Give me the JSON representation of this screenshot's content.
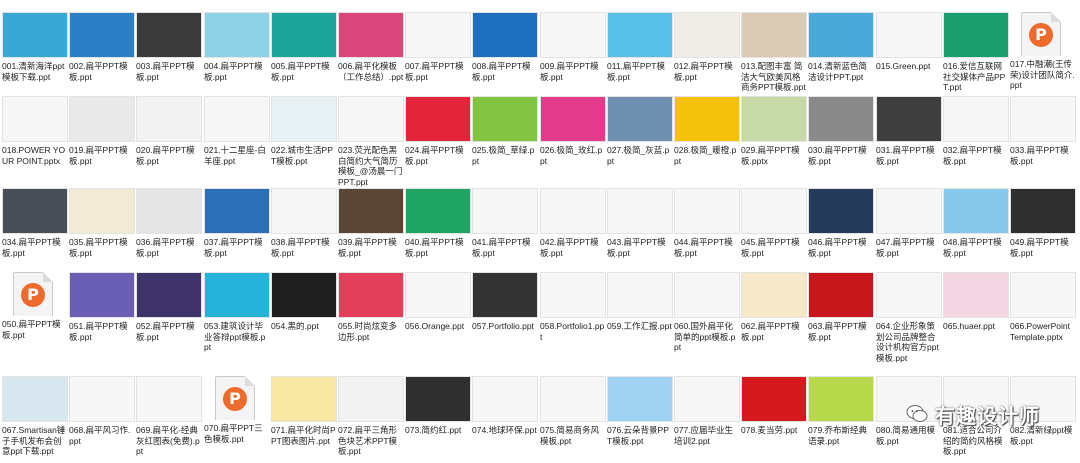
{
  "files": [
    {
      "name": "001.清新海洋ppt模板下载.ppt",
      "t": "sea"
    },
    {
      "name": "002.扁平PPT模板.ppt",
      "t": "blue"
    },
    {
      "name": "003.扁平PPT模板.ppt",
      "t": "dark"
    },
    {
      "name": "004.扁平PPT模板.ppt",
      "t": "lightblue"
    },
    {
      "name": "005.扁平PPT模板.ppt",
      "t": "teal"
    },
    {
      "name": "006.扁平化模板（工作总结）.ppt",
      "t": "pink"
    },
    {
      "name": "007.扁平PPT模板.ppt",
      "t": "white"
    },
    {
      "name": "008.扁平PPT模板.ppt",
      "t": "blue2"
    },
    {
      "name": "009.扁平PPT模板.ppt",
      "t": "white"
    },
    {
      "name": "011.扁平PPT模板.ppt",
      "t": "sky"
    },
    {
      "name": "012.扁平PPT模板.ppt",
      "t": "paper"
    },
    {
      "name": "013.配图丰富 简洁大气欧美风格商务PPT模板.ppt",
      "t": "beige"
    },
    {
      "name": "014.清新蓝色简洁设计PPT.ppt",
      "t": "social"
    },
    {
      "name": "015.Green.ppt",
      "t": "white"
    },
    {
      "name": "016.爱信互联网社交媒体产品PPT.ppt",
      "t": "green"
    },
    {
      "name": "017.中融潮(王传荣)设计团队简介.ppt",
      "t": "file"
    },
    {
      "name": "018.POWER YOUR POINT.pptx",
      "t": "white"
    },
    {
      "name": "019.扁平PPT模板.ppt",
      "t": "people"
    },
    {
      "name": "020.扁平PPT模板.ppt",
      "t": "leaves"
    },
    {
      "name": "021.十二星座-白羊座.ppt",
      "t": "white"
    },
    {
      "name": "022.城市生活PPT模板.ppt",
      "t": "city"
    },
    {
      "name": "023.荧光配色黑白简约大气简历模板_@汤晨一门PPT.ppt",
      "t": "white"
    },
    {
      "name": "024.扁平PPT模板.ppt",
      "t": "red"
    },
    {
      "name": "025.极简_草绿.ppt",
      "t": "lime"
    },
    {
      "name": "026.极简_玫红.ppt",
      "t": "magenta"
    },
    {
      "name": "027.极简_灰蓝.ppt",
      "t": "greyblue"
    },
    {
      "name": "028.极简_暖橙.ppt",
      "t": "yellow"
    },
    {
      "name": "029.扁平PPT模板.pptx",
      "t": "greenL"
    },
    {
      "name": "030.扁平PPT模板.ppt",
      "t": "grey"
    },
    {
      "name": "031.扁平PPT模板.ppt",
      "t": "orangeD"
    },
    {
      "name": "032.扁平PPT模板.ppt",
      "t": "white"
    },
    {
      "name": "033.扁平PPT模板.ppt",
      "t": "white"
    },
    {
      "name": "034.扁平PPT模板.ppt",
      "t": "darkslate"
    },
    {
      "name": "035.扁平PPT模板.ppt",
      "t": "cream"
    },
    {
      "name": "036.扁平PPT模板.ppt",
      "t": "stripes"
    },
    {
      "name": "037.扁平PPT模板.ppt",
      "t": "techful"
    },
    {
      "name": "038.扁平PPT模板.ppt",
      "t": "white"
    },
    {
      "name": "039.扁平PPT模板.ppt",
      "t": "brown"
    },
    {
      "name": "040.扁平PPT模板.ppt",
      "t": "green2"
    },
    {
      "name": "041.扁平PPT模板.ppt",
      "t": "white"
    },
    {
      "name": "042.扁平PPT模板.ppt",
      "t": "white"
    },
    {
      "name": "043.扁平PPT模板.ppt",
      "t": "white"
    },
    {
      "name": "044.扁平PPT模板.ppt",
      "t": "white"
    },
    {
      "name": "045.扁平PPT模板.ppt",
      "t": "white"
    },
    {
      "name": "046.扁平PPT模板.ppt",
      "t": "navy"
    },
    {
      "name": "047.扁平PPT模板.ppt",
      "t": "white"
    },
    {
      "name": "048.扁平PPT模板.ppt",
      "t": "skyline"
    },
    {
      "name": "049.扁平PPT模板.ppt",
      "t": "charcoal"
    },
    {
      "name": "050.扁平PPT模板.ppt",
      "t": "file"
    },
    {
      "name": "051.扁平PPT模板.ppt",
      "t": "violet"
    },
    {
      "name": "052.扁平PPT模板.ppt",
      "t": "purpleD"
    },
    {
      "name": "053.建筑设计毕业答辩ppt模板.ppt",
      "t": "cyan"
    },
    {
      "name": "054.黑的.ppt",
      "t": "black"
    },
    {
      "name": "055.时尚炫变多边形.ppt",
      "t": "poly"
    },
    {
      "name": "056.Orange.ppt",
      "t": "white"
    },
    {
      "name": "057.Portfolio.ppt",
      "t": "portfolio"
    },
    {
      "name": "058.Portfolio1.ppt",
      "t": "white"
    },
    {
      "name": "059.工作汇报.ppt",
      "t": "white"
    },
    {
      "name": "060.国外扁平化简单的ppt模板.ppt",
      "t": "white"
    },
    {
      "name": "062.扁平PPT模板.ppt",
      "t": "bunting"
    },
    {
      "name": "063.扁平PPT模板.ppt",
      "t": "redfest"
    },
    {
      "name": "064.企业形象策划公司品牌整合设计机构官方ppt模板.ppt",
      "t": "white"
    },
    {
      "name": "065.huaer.ppt",
      "t": "pinkL"
    },
    {
      "name": "066.PowerPoint Template.pptx",
      "t": "white"
    },
    {
      "name": "067.Smartisan锤子手机发布会创意ppt下载.ppt",
      "t": "cartoon"
    },
    {
      "name": "068.扁平风习作.ppt",
      "t": "white"
    },
    {
      "name": "069.扁平化-经典灰红图表(免费).ppt",
      "t": "white"
    },
    {
      "name": "070.扁平PPT三色模板.ppt",
      "t": "file"
    },
    {
      "name": "071.扁平化时尚PPT图表图片.ppt",
      "t": "yellowL"
    },
    {
      "name": "072.扁平三角形色块艺术PPT模板.ppt",
      "t": "triangle"
    },
    {
      "name": "073.简约红.ppt",
      "t": "charcoal"
    },
    {
      "name": "074.地球环保.ppt",
      "t": "white"
    },
    {
      "name": "075.简易商务风模板.ppt",
      "t": "white"
    },
    {
      "name": "076.云朵背景PPT模板.ppt",
      "t": "clouds"
    },
    {
      "name": "077.应届毕业生培训2.ppt",
      "t": "white"
    },
    {
      "name": "078.麦当劳.ppt",
      "t": "mcd"
    },
    {
      "name": "079.乔布斯经典语录.ppt",
      "t": "colorful"
    },
    {
      "name": "080.简易通用模板.ppt",
      "t": "white"
    },
    {
      "name": "081.适合公司介绍的简约风格模板.ppt",
      "t": "white"
    },
    {
      "name": "082.清新绿ppt模板.ppt",
      "t": "white"
    }
  ],
  "watermark": {
    "text": "有趣设计师"
  },
  "colors": {
    "sea": "#38a9d6",
    "blue": "#2b7fc4",
    "dark": "#3a3a3a",
    "lightblue": "#8fd2e6",
    "teal": "#1ba59b",
    "pink": "#d9477a",
    "white": "#f7f7f7",
    "blue2": "#1f6fbf",
    "sky": "#58c0e8",
    "paper": "#f0ece6",
    "beige": "#d9cbb6",
    "social": "#4aa8d8",
    "green": "#1a9e6e",
    "people": "#e9e9e9",
    "leaves": "#f3f3f3",
    "city": "#e8f1f4",
    "red": "#e4243b",
    "lime": "#82c341",
    "magenta": "#e23b8c",
    "greyblue": "#6e8fb0",
    "yellow": "#f4c20d",
    "greenL": "#c6d9a6",
    "grey": "#8a8a8a",
    "orangeD": "#3e3e3e",
    "darkslate": "#4a4e57",
    "cream": "#f3ead6",
    "stripes": "#e5e5e5",
    "techful": "#2c6fb7",
    "brown": "#5a4635",
    "green2": "#1fa463",
    "navy": "#253a5b",
    "skyline": "#87c9ea",
    "charcoal": "#2f2f2f",
    "violet": "#6b5fb5",
    "purpleD": "#3d3368",
    "cyan": "#27b3d9",
    "black": "#1e1e1e",
    "poly": "#e33e5a",
    "portfolio": "#343434",
    "bunting": "#f6e9c9",
    "redfest": "#c7171d",
    "pinkL": "#f4d6e2",
    "cartoon": "#d8e6ef",
    "yellowL": "#f9e8a3",
    "triangle": "#f2f2f2",
    "clouds": "#9fd3f1",
    "mcd": "#d6191f",
    "colorful": "#b7d84a"
  }
}
